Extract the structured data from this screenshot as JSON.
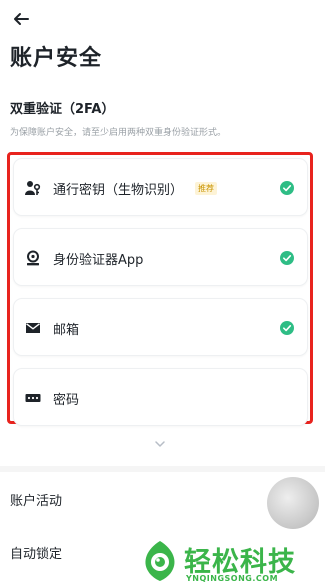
{
  "page": {
    "title": "账户安全"
  },
  "twofa": {
    "title": "双重验证（2FA）",
    "description": "为保障账户安全，请至少启用两种双重身份验证形式。",
    "items": [
      {
        "label": "通行密钥（生物识别）",
        "badge": "推荐",
        "icon": "passkey-icon",
        "enabled": true
      },
      {
        "label": "身份验证器App",
        "icon": "authenticator-icon",
        "enabled": true
      },
      {
        "label": "邮箱",
        "icon": "mail-icon",
        "enabled": true
      },
      {
        "label": "密码",
        "icon": "password-icon",
        "enabled": false
      }
    ]
  },
  "rows": {
    "account_activity": "账户活动",
    "auto_lock": "自动锁定"
  },
  "watermark": {
    "name": "轻松科技",
    "domain": "YNQINGSONG.COM"
  },
  "colors": {
    "check": "#2ebd85",
    "highlight_frame": "#e8231e",
    "badge_text": "#c99400",
    "watermark": "#3bb54a"
  }
}
